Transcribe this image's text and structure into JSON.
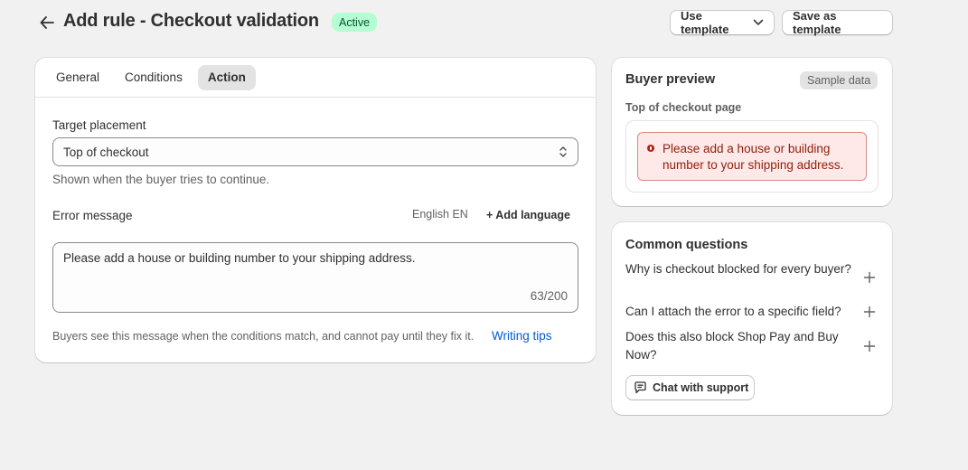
{
  "header": {
    "title": "Add rule - Checkout validation",
    "status": "Active",
    "use_template_label": "Use template",
    "save_template_label": "Save as template"
  },
  "tabs": [
    {
      "label": "General",
      "active": false
    },
    {
      "label": "Conditions",
      "active": false
    },
    {
      "label": "Action",
      "active": true
    }
  ],
  "action": {
    "target_label": "Target placement",
    "target_value": "Top of checkout",
    "target_help": "Shown when the buyer tries to continue.",
    "error_label": "Error message",
    "language": "English EN",
    "add_language": "+ Add language",
    "message": "Please add a house or building number to your shipping address.",
    "char_count": "63/200",
    "footer_help": "Buyers see this message when the conditions match, and cannot pay until they fix it.",
    "writing_tips": "Writing tips"
  },
  "preview": {
    "title": "Buyer preview",
    "badge": "Sample data",
    "subtitle": "Top of checkout page",
    "error_text": "Please add a house or building number to your shipping address."
  },
  "faq": {
    "title": "Common questions",
    "questions": [
      "Why is checkout blocked for every buyer?",
      "Can I attach the error to a specific field?",
      "Does this also block Shop Pay and Buy Now?"
    ],
    "chat_label": "Chat with support"
  },
  "colors": {
    "page_bg": "#f1f1f1",
    "active_badge_bg": "#b4fed2",
    "active_badge_text": "#0c5132",
    "error_bg": "#fee9e8",
    "error_text": "#8e1f0b",
    "link": "#005bd3"
  },
  "icons": {
    "back": "arrow-left-icon",
    "dropdown": "chevron-down-icon",
    "select": "select-chevrons-icon",
    "error": "alert-dot-icon",
    "expand": "plus-icon",
    "chat": "chat-bubble-icon"
  }
}
